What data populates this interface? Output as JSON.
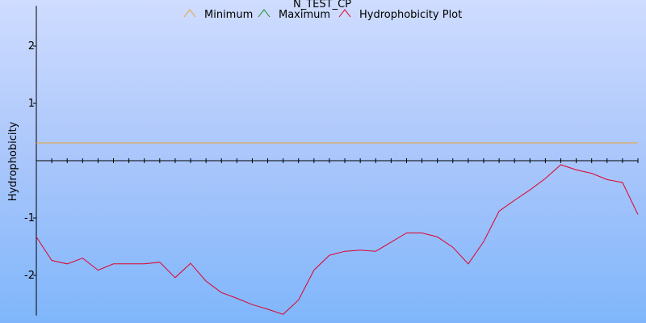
{
  "chart_data": {
    "type": "line",
    "title": "N_TEST_CP",
    "ylabel": "Hydrophobicity",
    "xlabel": "",
    "ylim": [
      -2.7,
      2.7
    ],
    "yticks": [
      2,
      1,
      -1,
      -2
    ],
    "ytick_labels": [
      "2",
      "1",
      "-1",
      "-2"
    ],
    "x_tick_count": 40,
    "grid": false,
    "legend_position": "top",
    "series": [
      {
        "name": "Minimum",
        "color": "#e8a33a",
        "values": [
          0.31,
          0.31
        ]
      },
      {
        "name": "Maximum",
        "color": "#1d8b1d",
        "values": []
      },
      {
        "name": "Hydrophobicity Plot",
        "color": "#e0002a",
        "values": [
          -1.33,
          -1.74,
          -1.8,
          -1.7,
          -1.91,
          -1.8,
          -1.8,
          -1.8,
          -1.77,
          -2.04,
          -1.79,
          -2.1,
          -2.3,
          -2.4,
          -2.51,
          -2.59,
          -2.68,
          -2.43,
          -1.91,
          -1.65,
          -1.58,
          -1.56,
          -1.58,
          -1.42,
          -1.26,
          -1.26,
          -1.33,
          -1.51,
          -1.8,
          -1.41,
          -0.88,
          -0.69,
          -0.51,
          -0.31,
          -0.07,
          -0.16,
          -0.22,
          -0.33,
          -0.38,
          -0.94
        ]
      }
    ]
  }
}
